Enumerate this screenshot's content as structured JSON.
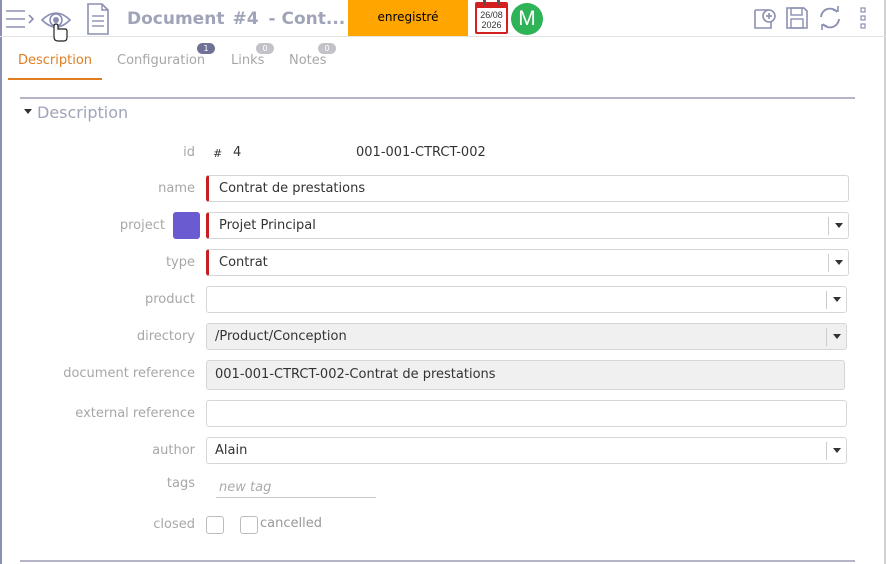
{
  "header": {
    "title": "Document",
    "number": "#4",
    "subtitle": "- Cont...",
    "status": "enregistré",
    "status_color": "#ffa500",
    "calendar_date": "26/08",
    "calendar_year": "2026",
    "avatar_letter": "M",
    "avatar_color": "#2eb357",
    "icons": [
      "menu-arrow-icon",
      "eye-icon",
      "document-icon",
      "calendar-icon",
      "new-item-icon",
      "save-icon",
      "refresh-icon",
      "more-vertical-icon"
    ]
  },
  "tabs": [
    {
      "label": "Description",
      "badge": ""
    },
    {
      "label": "Configuration",
      "badge": "1"
    },
    {
      "label": "Links",
      "badge": "0"
    },
    {
      "label": "Notes",
      "badge": "0"
    }
  ],
  "accent_color": "#e07d22",
  "section": {
    "title": "Description"
  },
  "form": {
    "id": {
      "label": "id",
      "hash": "#",
      "value": "4",
      "reference": "001-001-CTRCT-002"
    },
    "name": {
      "label": "name",
      "value": "Contrat de prestations"
    },
    "project": {
      "label": "project",
      "value": "Projet Principal",
      "color": "#6b5bd0"
    },
    "type": {
      "label": "type",
      "value": "Contrat"
    },
    "product": {
      "label": "product",
      "value": ""
    },
    "directory": {
      "label": "directory",
      "value": "/Product/Conception"
    },
    "document_reference": {
      "label": "document reference",
      "value": "001-001-CTRCT-002-Contrat de prestations"
    },
    "external_reference": {
      "label": "external reference",
      "value": ""
    },
    "author": {
      "label": "author",
      "value": "Alain"
    },
    "tags": {
      "label": "tags",
      "placeholder": "new tag"
    },
    "closed": {
      "label": "closed"
    },
    "cancelled": {
      "label": "cancelled"
    }
  }
}
